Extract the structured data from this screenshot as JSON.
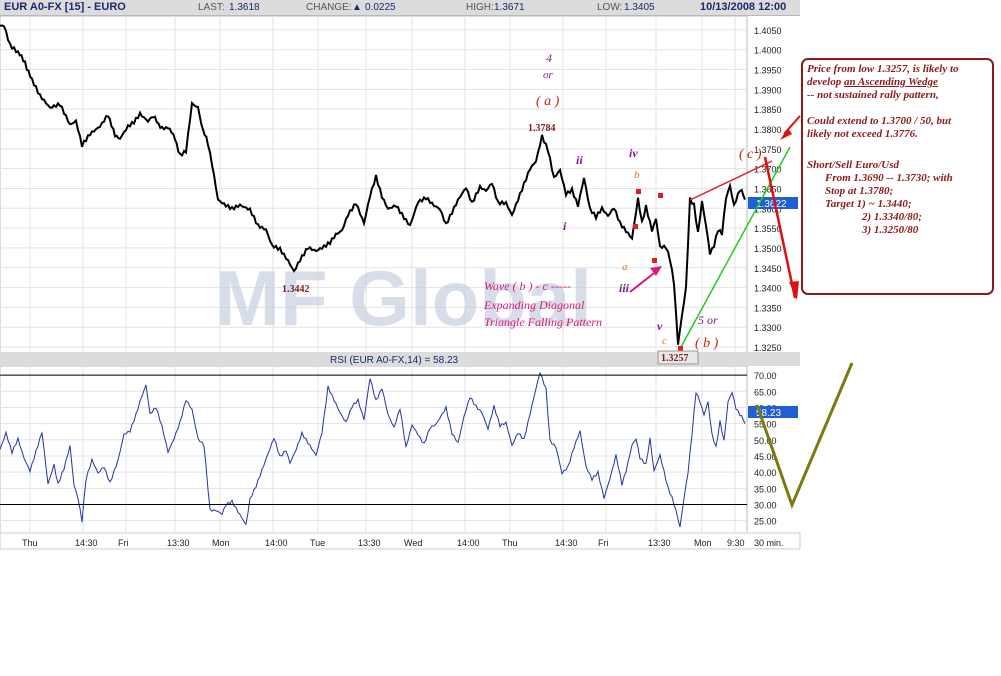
{
  "header": {
    "symbol": "EUR A0-FX [15] - EURO",
    "last_label": "LAST:",
    "last_value": "1.3618",
    "change_label": "CHANGE:",
    "change_value": "0.0225",
    "high_label": "HIGH:",
    "high_value": "1.3671",
    "low_label": "LOW:",
    "low_value": "1.3405",
    "datetime": "10/13/2008 12:00"
  },
  "colors": {
    "price": "#000000",
    "rsi": "#2233aa",
    "wave_label": "#cc2200",
    "wave_count": "#7a1f8a",
    "sub_wave": "#e07020",
    "annotation": "#d81b7a",
    "wedge_upper": "#e02020",
    "wedge_lower": "#22cc22",
    "forecast_rsi": "#7a7a10",
    "forecast_price": "#dd1111",
    "note": "#8b1a1a",
    "panel_bg": "#dcdcdc",
    "current_tag": "#1f5fd1"
  },
  "chart_data": [
    {
      "type": "line",
      "series": [],
      "x_tick_labels": [
        "Thu",
        "14:30",
        "Fri",
        "13:30",
        "Mon",
        "14:00",
        "Tue",
        "13:30",
        "Wed",
        "14:00",
        "Thu",
        "14:30",
        "Fri",
        "13:30",
        "Mon",
        "9:30",
        "30 min."
      ],
      "y_tick_labels": [
        "1.4050",
        "1.4000",
        "1.3950",
        "1.3900",
        "1.3850",
        "1.3800",
        "1.3750",
        "1.3700",
        "1.3650",
        "1.3600",
        "1.3550",
        "1.3500",
        "1.3450",
        "1.3400",
        "1.3350",
        "1.3300",
        "1.3250"
      ],
      "ylim": [
        1.3235,
        1.4085
      ],
      "current_value": "1.3622",
      "price_path_anchors": [
        [
          0,
          1.406
        ],
        [
          4,
          1.406
        ],
        [
          10,
          1.401
        ],
        [
          18,
          1.399
        ],
        [
          25,
          1.397
        ],
        [
          32,
          1.392
        ],
        [
          40,
          1.388
        ],
        [
          50,
          1.385
        ],
        [
          60,
          1.386
        ],
        [
          70,
          1.381
        ],
        [
          76,
          1.382
        ],
        [
          82,
          1.376
        ],
        [
          90,
          1.379
        ],
        [
          100,
          1.381
        ],
        [
          108,
          1.384
        ],
        [
          115,
          1.378
        ],
        [
          120,
          1.378
        ],
        [
          128,
          1.381
        ],
        [
          134,
          1.382
        ],
        [
          140,
          1.384
        ],
        [
          148,
          1.382
        ],
        [
          155,
          1.383
        ],
        [
          162,
          1.38
        ],
        [
          168,
          1.38
        ],
        [
          175,
          1.378
        ],
        [
          180,
          1.373
        ],
        [
          186,
          1.374
        ],
        [
          192,
          1.386
        ],
        [
          198,
          1.385
        ],
        [
          203,
          1.38
        ],
        [
          208,
          1.376
        ],
        [
          212,
          1.371
        ],
        [
          214,
          1.368
        ],
        [
          218,
          1.362
        ],
        [
          224,
          1.361
        ],
        [
          232,
          1.36
        ],
        [
          240,
          1.361
        ],
        [
          250,
          1.36
        ],
        [
          258,
          1.356
        ],
        [
          266,
          1.355
        ],
        [
          272,
          1.351
        ],
        [
          280,
          1.35
        ],
        [
          288,
          1.347
        ],
        [
          294,
          1.3442
        ],
        [
          300,
          1.347
        ],
        [
          308,
          1.35
        ],
        [
          316,
          1.349
        ],
        [
          324,
          1.35
        ],
        [
          330,
          1.351
        ],
        [
          336,
          1.353
        ],
        [
          342,
          1.354
        ],
        [
          348,
          1.358
        ],
        [
          356,
          1.361
        ],
        [
          364,
          1.356
        ],
        [
          370,
          1.363
        ],
        [
          376,
          1.368
        ],
        [
          382,
          1.363
        ],
        [
          388,
          1.36
        ],
        [
          396,
          1.361
        ],
        [
          404,
          1.358
        ],
        [
          410,
          1.356
        ],
        [
          418,
          1.362
        ],
        [
          426,
          1.363
        ],
        [
          434,
          1.361
        ],
        [
          440,
          1.36
        ],
        [
          446,
          1.356
        ],
        [
          452,
          1.359
        ],
        [
          458,
          1.362
        ],
        [
          466,
          1.365
        ],
        [
          472,
          1.361
        ],
        [
          480,
          1.365
        ],
        [
          486,
          1.364
        ],
        [
          492,
          1.366
        ],
        [
          498,
          1.361
        ],
        [
          506,
          1.361
        ],
        [
          512,
          1.358
        ],
        [
          518,
          1.362
        ],
        [
          524,
          1.366
        ],
        [
          530,
          1.37
        ],
        [
          536,
          1.372
        ],
        [
          542,
          1.3784
        ],
        [
          548,
          1.375
        ],
        [
          554,
          1.368
        ],
        [
          560,
          1.37
        ],
        [
          566,
          1.364
        ],
        [
          572,
          1.365
        ],
        [
          578,
          1.361
        ],
        [
          584,
          1.368
        ],
        [
          590,
          1.36
        ],
        [
          596,
          1.358
        ],
        [
          602,
          1.36
        ],
        [
          608,
          1.358
        ],
        [
          614,
          1.36
        ],
        [
          620,
          1.356
        ],
        [
          626,
          1.354
        ],
        [
          632,
          1.352
        ],
        [
          638,
          1.362
        ],
        [
          642,
          1.356
        ],
        [
          646,
          1.36
        ],
        [
          652,
          1.354
        ],
        [
          656,
          1.357
        ],
        [
          660,
          1.35
        ],
        [
          666,
          1.35
        ],
        [
          670,
          1.347
        ],
        [
          674,
          1.341
        ],
        [
          678,
          1.3257
        ],
        [
          682,
          1.333
        ],
        [
          686,
          1.34
        ],
        [
          690,
          1.3625
        ],
        [
          694,
          1.361
        ],
        [
          698,
          1.354
        ],
        [
          702,
          1.362
        ],
        [
          706,
          1.356
        ],
        [
          710,
          1.349
        ],
        [
          714,
          1.351
        ],
        [
          718,
          1.355
        ],
        [
          722,
          1.354
        ],
        [
          726,
          1.363
        ],
        [
          730,
          1.366
        ],
        [
          734,
          1.361
        ],
        [
          740,
          1.365
        ],
        [
          745,
          1.3622
        ]
      ],
      "price_labels": [
        {
          "text": "1.3784",
          "x": 542,
          "y": 1.3784
        },
        {
          "text": "1.3442",
          "x": 294,
          "y": 1.3442
        },
        {
          "text": "1.3257",
          "x": 678,
          "y": 1.3257
        }
      ],
      "wave_labels": {
        "a_four": "4",
        "a_or": "or",
        "a": "( a )",
        "ii": "ii",
        "i": "i",
        "iv": "iv",
        "b_small": "b",
        "a_small": "a",
        "iii": "iii",
        "v": "v",
        "c_small": "c",
        "five_or": "5 or",
        "b": "( b )",
        "c": "( c )"
      },
      "annotation": {
        "line1": "Wave ( b ) - c   -----",
        "line2": "Expanding Diagonal",
        "line3": "Triangle Falling Pattern"
      },
      "watermark": "MF Global"
    },
    {
      "type": "line",
      "title": "RSI (EUR A0-FX,14) = 58.23",
      "series": [],
      "y_tick_labels": [
        "70.00",
        "65.00",
        "60.00",
        "55.00",
        "50.00",
        "45.00",
        "40.00",
        "35.00",
        "30.00",
        "25.00"
      ],
      "ylim": [
        21.5,
        72.5
      ],
      "reference_levels": [
        70,
        30
      ],
      "current_value": "58.23",
      "rsi_path_anchors": [
        [
          0,
          47
        ],
        [
          6,
          52
        ],
        [
          12,
          46
        ],
        [
          18,
          50
        ],
        [
          24,
          44
        ],
        [
          30,
          40
        ],
        [
          36,
          46
        ],
        [
          42,
          52
        ],
        [
          48,
          36
        ],
        [
          54,
          42
        ],
        [
          58,
          36
        ],
        [
          64,
          41
        ],
        [
          70,
          48
        ],
        [
          74,
          36
        ],
        [
          78,
          32
        ],
        [
          82,
          25
        ],
        [
          86,
          38
        ],
        [
          92,
          44
        ],
        [
          98,
          40
        ],
        [
          104,
          42
        ],
        [
          110,
          37
        ],
        [
          118,
          44
        ],
        [
          124,
          52
        ],
        [
          130,
          53
        ],
        [
          136,
          58
        ],
        [
          140,
          62
        ],
        [
          146,
          67
        ],
        [
          150,
          58
        ],
        [
          156,
          60
        ],
        [
          162,
          54
        ],
        [
          168,
          46
        ],
        [
          174,
          50
        ],
        [
          180,
          55
        ],
        [
          186,
          62
        ],
        [
          192,
          59
        ],
        [
          198,
          50
        ],
        [
          204,
          48
        ],
        [
          210,
          28
        ],
        [
          216,
          28
        ],
        [
          222,
          27
        ],
        [
          226,
          30
        ],
        [
          232,
          31
        ],
        [
          238,
          28
        ],
        [
          242,
          26
        ],
        [
          246,
          24
        ],
        [
          250,
          32
        ],
        [
          256,
          36
        ],
        [
          262,
          41
        ],
        [
          268,
          46
        ],
        [
          274,
          51
        ],
        [
          280,
          45
        ],
        [
          286,
          47
        ],
        [
          290,
          43
        ],
        [
          296,
          47
        ],
        [
          302,
          52
        ],
        [
          310,
          48
        ],
        [
          316,
          45
        ],
        [
          322,
          52
        ],
        [
          328,
          66
        ],
        [
          334,
          62
        ],
        [
          340,
          58
        ],
        [
          346,
          55
        ],
        [
          352,
          60
        ],
        [
          358,
          62
        ],
        [
          364,
          56
        ],
        [
          370,
          69
        ],
        [
          376,
          62
        ],
        [
          382,
          66
        ],
        [
          388,
          58
        ],
        [
          394,
          54
        ],
        [
          400,
          60
        ],
        [
          406,
          48
        ],
        [
          412,
          55
        ],
        [
          418,
          52
        ],
        [
          424,
          49
        ],
        [
          430,
          54
        ],
        [
          436,
          55
        ],
        [
          442,
          58
        ],
        [
          446,
          60
        ],
        [
          452,
          52
        ],
        [
          458,
          49
        ],
        [
          464,
          57
        ],
        [
          470,
          63
        ],
        [
          476,
          60
        ],
        [
          482,
          58
        ],
        [
          488,
          53
        ],
        [
          494,
          60
        ],
        [
          500,
          54
        ],
        [
          506,
          55
        ],
        [
          512,
          48
        ],
        [
          518,
          52
        ],
        [
          524,
          50
        ],
        [
          530,
          58
        ],
        [
          536,
          66
        ],
        [
          540,
          71
        ],
        [
          546,
          66
        ],
        [
          550,
          50
        ],
        [
          556,
          48
        ],
        [
          562,
          40
        ],
        [
          568,
          42
        ],
        [
          574,
          48
        ],
        [
          580,
          53
        ],
        [
          586,
          42
        ],
        [
          592,
          38
        ],
        [
          598,
          40
        ],
        [
          604,
          32
        ],
        [
          610,
          38
        ],
        [
          616,
          45
        ],
        [
          622,
          36
        ],
        [
          626,
          40
        ],
        [
          632,
          48
        ],
        [
          636,
          50
        ],
        [
          640,
          44
        ],
        [
          646,
          42
        ],
        [
          650,
          50
        ],
        [
          654,
          40
        ],
        [
          660,
          45
        ],
        [
          664,
          40
        ],
        [
          668,
          35
        ],
        [
          672,
          32
        ],
        [
          676,
          28
        ],
        [
          680,
          23
        ],
        [
          684,
          32
        ],
        [
          688,
          40
        ],
        [
          692,
          52
        ],
        [
          696,
          65
        ],
        [
          700,
          62
        ],
        [
          704,
          58
        ],
        [
          708,
          62
        ],
        [
          712,
          52
        ],
        [
          716,
          48
        ],
        [
          720,
          56
        ],
        [
          724,
          50
        ],
        [
          728,
          62
        ],
        [
          732,
          65
        ],
        [
          736,
          60
        ],
        [
          740,
          58
        ],
        [
          745,
          55
        ]
      ]
    }
  ],
  "note": {
    "line1": "Price from low 1.3257, is likely to",
    "line2_pre": "develop ",
    "line2_ul": "an Ascending Wedge",
    "line3": "-- not sustained rally pattern,",
    "line4": "Could extend to 1.3700 / 50, but",
    "line5": "likely not exceed 1.3776.",
    "line6": "Short/Sell Euro/Usd",
    "line7": "From 1.3690 -- 1.3730; with",
    "line8": "Stop at 1.3780;",
    "line9": "Target 1) ~ 1.3440;",
    "line10": "2) 1.3340/80;",
    "line11": "3) 1.3250/80"
  }
}
